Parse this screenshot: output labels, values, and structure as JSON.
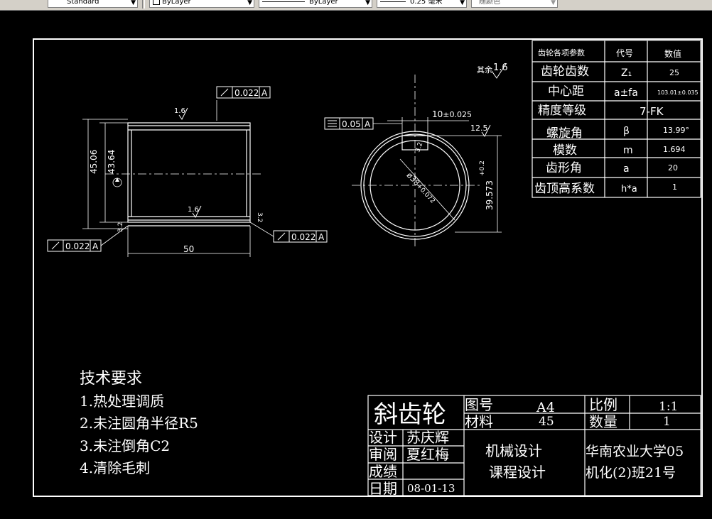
{
  "toolbar": {
    "text_style": "Standard",
    "layer": "ByLayer",
    "linetype": "ByLayer",
    "lineweight": "0.25 毫米",
    "color": "随颜色"
  },
  "title_block": {
    "part_name": "斜齿轮",
    "drawing_no_label": "图号",
    "drawing_no": "A4",
    "material_label": "材料",
    "material": "45",
    "scale_label": "比例",
    "scale": "1:1",
    "quantity_label": "数量",
    "quantity": "1",
    "design_label": "设计",
    "designer": "苏庆辉",
    "review_label": "审阅",
    "reviewer": "夏红梅",
    "grade_label": "成绩",
    "date_label": "日期",
    "date": "08-01-13",
    "course_line1": "机械设计",
    "course_line2": "课程设计",
    "school_line1": "华南农业大学05",
    "school_line2": "机化(2)班21号"
  },
  "tech_requirements": {
    "title": "技术要求",
    "items": [
      "1.热处理调质",
      "2.未注圆角半径R5",
      "3.未注倒角C2",
      "4.清除毛刺"
    ]
  },
  "gear_params": {
    "headers": [
      "齿轮各项参数",
      "代号",
      "数值"
    ],
    "rows": [
      {
        "name": "齿轮齿数",
        "symbol": "Z₁",
        "value": "25"
      },
      {
        "name": "中心距",
        "symbol": "a±fa",
        "value": "103.01±0.035"
      },
      {
        "name": "精度等级",
        "symbol": "",
        "value": "7-FK"
      },
      {
        "name": "螺旋角",
        "symbol": "β",
        "value": "13.99°"
      },
      {
        "name": "模数",
        "symbol": "m",
        "value": "1.694"
      },
      {
        "name": "齿形角",
        "symbol": "a",
        "value": "20"
      },
      {
        "name": "齿顶高系数",
        "symbol": "h*a",
        "value": "1"
      }
    ]
  },
  "annotations": {
    "rest_roughness": "其余",
    "rest_roughness_value": "1.6",
    "runout_top": "0.022",
    "runout_right": "0.022",
    "runout_left": "0.022",
    "datum": "A",
    "symmetry": "0.05",
    "roughness_top": "1.6",
    "roughness_mid": "1.6",
    "roughness_side_right": "3.2",
    "roughness_side_left": "3.2",
    "roughness_keyway": "3.2",
    "roughness_keyside": "12.5",
    "dim_outer_dia": "45.06",
    "dim_root_dia": "43.64",
    "dim_width": "50",
    "dim_keyway_width": "10",
    "dim_keyway_tol": "±0.025",
    "dim_bore": "ø38",
    "dim_bore_tol": "+0.072",
    "dim_bore_tol2": "0",
    "dim_key_depth": "39.573",
    "dim_key_depth_tol_up": "+0.2",
    "dim_key_depth_tol_lo": "0"
  }
}
